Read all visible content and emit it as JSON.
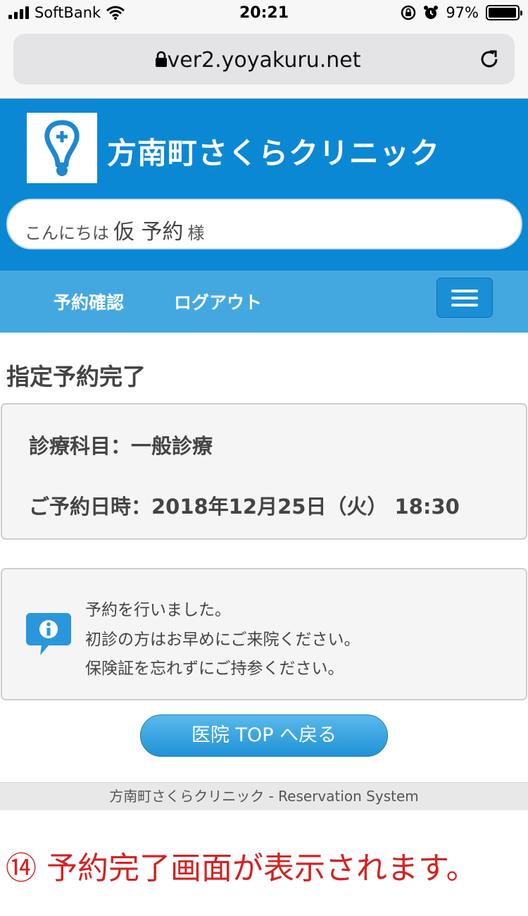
{
  "status_bar": {
    "carrier": "SoftBank",
    "time": "20:21",
    "battery": "97%",
    "battery_level": 0.97
  },
  "browser": {
    "url": "ver2.yoyakuru.net"
  },
  "header": {
    "clinic_name": "方南町さくらクリニック",
    "greeting_prefix": "こんにちは",
    "user_name": "仮 予約",
    "greeting_suffix": "様"
  },
  "nav": {
    "items": [
      {
        "label": "予約確認"
      },
      {
        "label": "ログアウト"
      }
    ]
  },
  "main": {
    "title": "指定予約完了",
    "details": {
      "department": "診療科目：一般診療",
      "datetime": "ご予約日時：2018年12月25日（火） 18:30"
    },
    "messages": [
      "予約を行いました。",
      "初診の方はお早めにご来院ください。",
      "保険証を忘れずにご持参ください。"
    ],
    "back_button": "医院 TOP へ戻る"
  },
  "footer": {
    "text": "方南町さくらクリニック - Reservation System"
  },
  "caption": "⑭ 予約完了画面が表示されます。",
  "colors": {
    "header": "#0b88d4",
    "nav": "#44a8e0",
    "caption": "#d42222"
  }
}
